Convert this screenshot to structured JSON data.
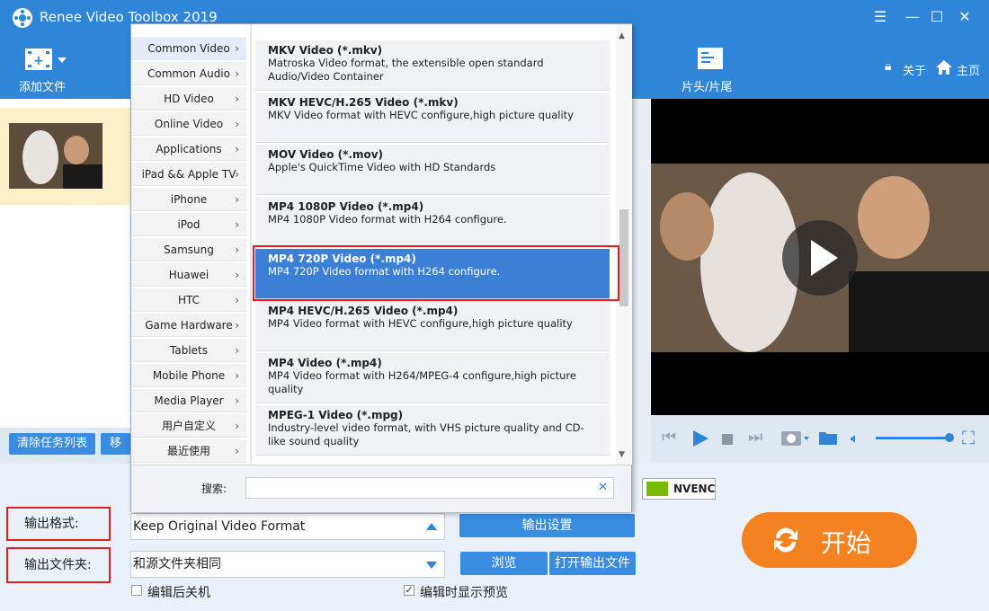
{
  "window": {
    "title": "Renee Video Toolbox 2019"
  },
  "toolbar": {
    "add_file": "添加文件",
    "head_tail": "片头/片尾",
    "about": "关于",
    "home": "主页"
  },
  "queue": {
    "clear_label": "清除任务列表",
    "move_label": "移"
  },
  "categories": [
    "Common Video",
    "Common Audio",
    "HD Video",
    "Online Video",
    "Applications",
    "iPad && Apple TV",
    "iPhone",
    "iPod",
    "Samsung",
    "Huawei",
    "HTC",
    "Game Hardware",
    "Tablets",
    "Mobile Phone",
    "Media Player",
    "用户自定义",
    "最近使用"
  ],
  "formats": [
    {
      "name": "MKV Video (*.mkv)",
      "desc": "Matroska Video format, the extensible open standard Audio/Video Container"
    },
    {
      "name": "MKV HEVC/H.265 Video (*.mkv)",
      "desc": "MKV Video format with HEVC configure,high picture quality"
    },
    {
      "name": "MOV Video (*.mov)",
      "desc": "Apple's QuickTime Video with HD Standards"
    },
    {
      "name": "MP4 1080P Video (*.mp4)",
      "desc": "MP4 1080P Video format with H264 configure."
    },
    {
      "name": "MP4 720P Video (*.mp4)",
      "desc": "MP4 720P Video format with H264 configure."
    },
    {
      "name": "MP4 HEVC/H.265 Video (*.mp4)",
      "desc": "MP4 Video format with HEVC configure,high picture quality"
    },
    {
      "name": "MP4 Video (*.mp4)",
      "desc": "MP4 Video format with H264/MPEG-4 configure,high picture quality"
    },
    {
      "name": "MPEG-1 Video (*.mpg)",
      "desc": "Industry-level video format, with VHS picture quality and CD-like sound quality"
    }
  ],
  "search": {
    "label": "搜索:",
    "value": ""
  },
  "output": {
    "format_label": "输出格式:",
    "format_value": "Keep Original Video Format",
    "settings_button": "输出设置",
    "folder_label": "输出文件夹:",
    "folder_value": "和源文件夹相同",
    "browse_button": "浏览",
    "open_folder_button": "打开输出文件",
    "shutdown_label": "编辑后关机",
    "shutdown_checked": false,
    "preview_label": "编辑时显示预览",
    "preview_checked": true
  },
  "start_button": "开始",
  "nvenc_label": "NVENC"
}
